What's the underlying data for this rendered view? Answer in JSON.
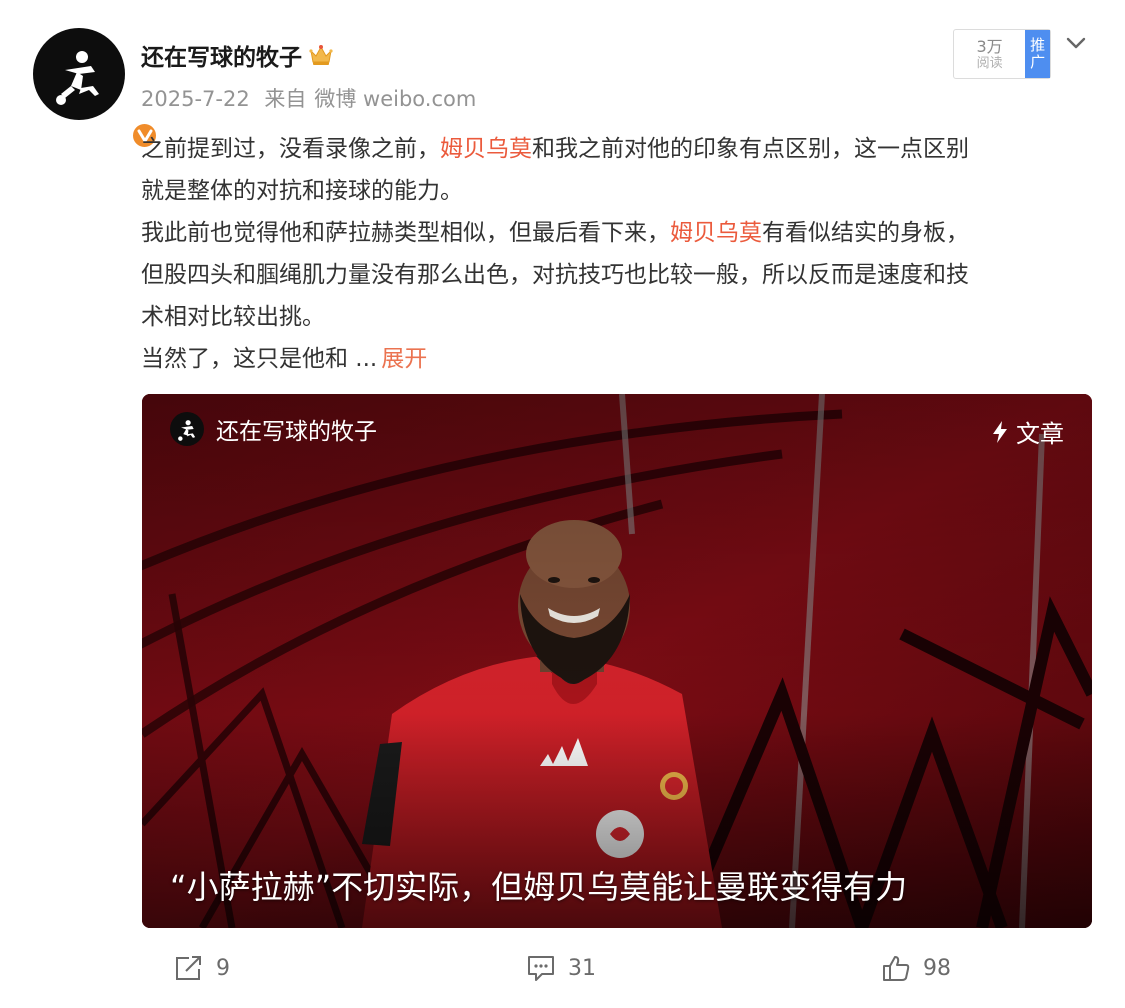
{
  "post": {
    "author": "还在写球的牧子",
    "date": "2025-7-22",
    "source_prefix": "来自",
    "source": "微博 weibo.com",
    "read_count": "3万",
    "read_label": "阅读",
    "promo_badge": "推广"
  },
  "body": {
    "p1_a": "之前提到过，没看录像之前，",
    "p1_hl": "姆贝乌莫",
    "p1_b": "和我之前对他的印象有点区别，这一点区别",
    "p1_c": "就是整体的对抗和接球的能力。",
    "p2_a": "我此前也觉得他和萨拉赫类型相似，但最后看下来，",
    "p2_hl": "姆贝乌莫",
    "p2_b": "有看似结实的身板，",
    "p2_c": "但股四头和腘绳肌力量没有那么出色，对抗技巧也比较一般，所以反而是速度和技",
    "p2_d": "术相对比较出挑。",
    "p3_a": "当然了，这只是他和  ...",
    "expand": "展开"
  },
  "card": {
    "author": "还在写球的牧子",
    "tag": "文章",
    "title": "“小萨拉赫”不切实际，但姆贝乌莫能让曼联变得有力"
  },
  "actions": {
    "share_count": "9",
    "comment_count": "31",
    "like_count": "98"
  },
  "colors": {
    "highlight": "#eb5a3c",
    "expand": "#eb7350",
    "promo": "#4e8ef0",
    "verified": "#f08c2a"
  },
  "icons": [
    "crown-icon",
    "verified-icon",
    "chevron-down-icon",
    "lightning-icon",
    "share-icon",
    "comment-icon",
    "like-icon"
  ]
}
